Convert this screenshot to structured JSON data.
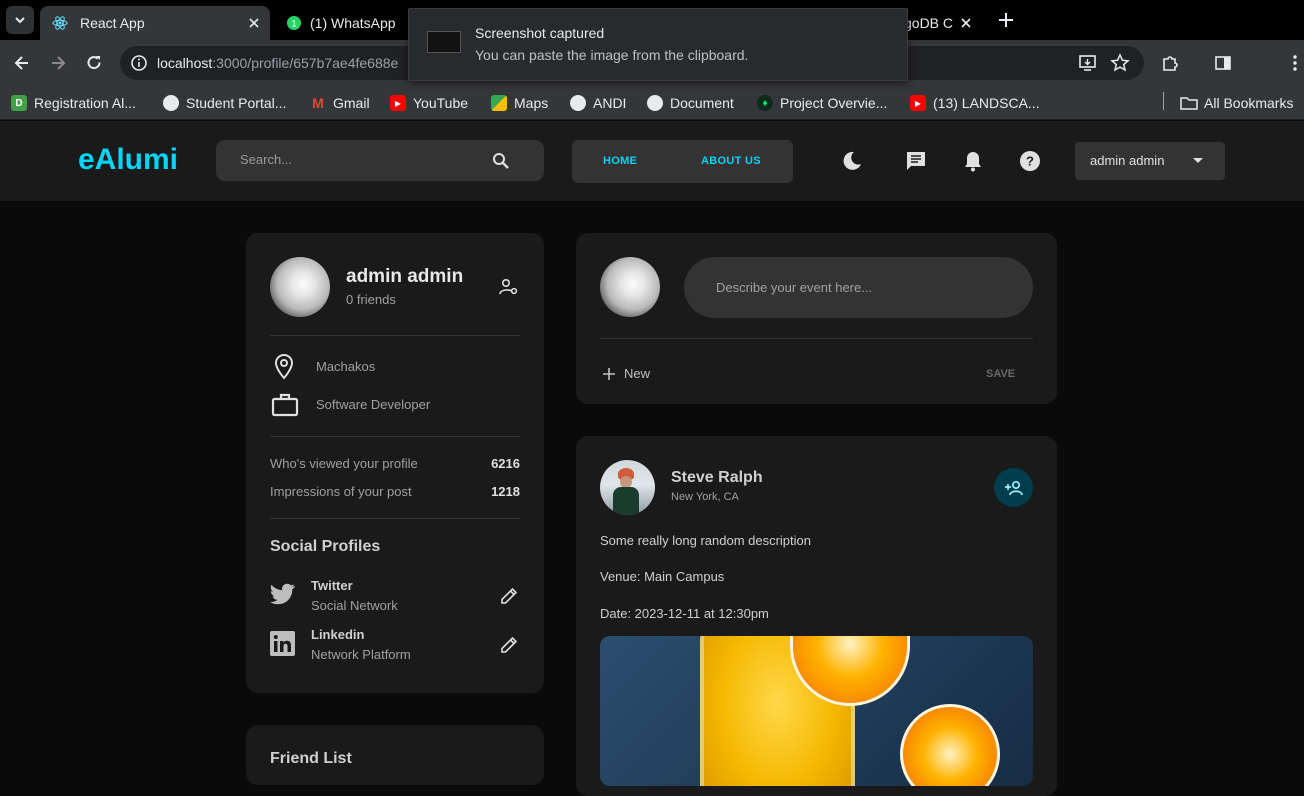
{
  "browser": {
    "tabs": [
      {
        "title": "React App",
        "active": true
      },
      {
        "title": "(1) WhatsApp",
        "active": false
      },
      {
        "title": "goDB C",
        "active": false
      }
    ],
    "url_host": "localhost",
    "url_rest": ":3000/profile/657b7ae4fe688e",
    "bookmarks": [
      {
        "label": "Registration Al...",
        "icon": "registration-icon"
      },
      {
        "label": "Student Portal...",
        "icon": "globe-icon"
      },
      {
        "label": "Gmail",
        "icon": "gmail-icon"
      },
      {
        "label": "YouTube",
        "icon": "youtube-icon"
      },
      {
        "label": "Maps",
        "icon": "maps-icon"
      },
      {
        "label": "ANDI",
        "icon": "globe-icon"
      },
      {
        "label": "Document",
        "icon": "globe-icon"
      },
      {
        "label": "Project Overvie...",
        "icon": "mongodb-icon"
      },
      {
        "label": "(13) LANDSCA...",
        "icon": "youtube-icon"
      }
    ],
    "all_bookmarks": "All Bookmarks"
  },
  "toast": {
    "title": "Screenshot captured",
    "message": "You can paste the image from the clipboard."
  },
  "app": {
    "logo": "eAlumi",
    "search_placeholder": "Search...",
    "nav": {
      "home": "HOME",
      "about": "ABOUT US"
    },
    "user_name": "admin admin"
  },
  "profile": {
    "name": "admin admin",
    "friends": "0 friends",
    "location": "Machakos",
    "occupation": "Software Developer",
    "stats": [
      {
        "label": "Who's viewed your profile",
        "value": "6216"
      },
      {
        "label": "Impressions of your post",
        "value": "1218"
      }
    ],
    "social_title": "Social Profiles",
    "social": [
      {
        "name": "Twitter",
        "type": "Social Network"
      },
      {
        "name": "Linkedin",
        "type": "Network Platform"
      }
    ]
  },
  "friend_list_title": "Friend List",
  "composer": {
    "placeholder": "Describe your event here...",
    "new_label": "New",
    "save_label": "SAVE"
  },
  "post": {
    "author": "Steve Ralph",
    "location": "New York, CA",
    "description": "Some really long random description",
    "venue": "Venue: Main Campus",
    "date": "Date: 2023-12-11 at 12:30pm"
  },
  "colors": {
    "accent": "#00d5fa",
    "card": "#1a1a1a",
    "page": "#0a0a0a"
  }
}
